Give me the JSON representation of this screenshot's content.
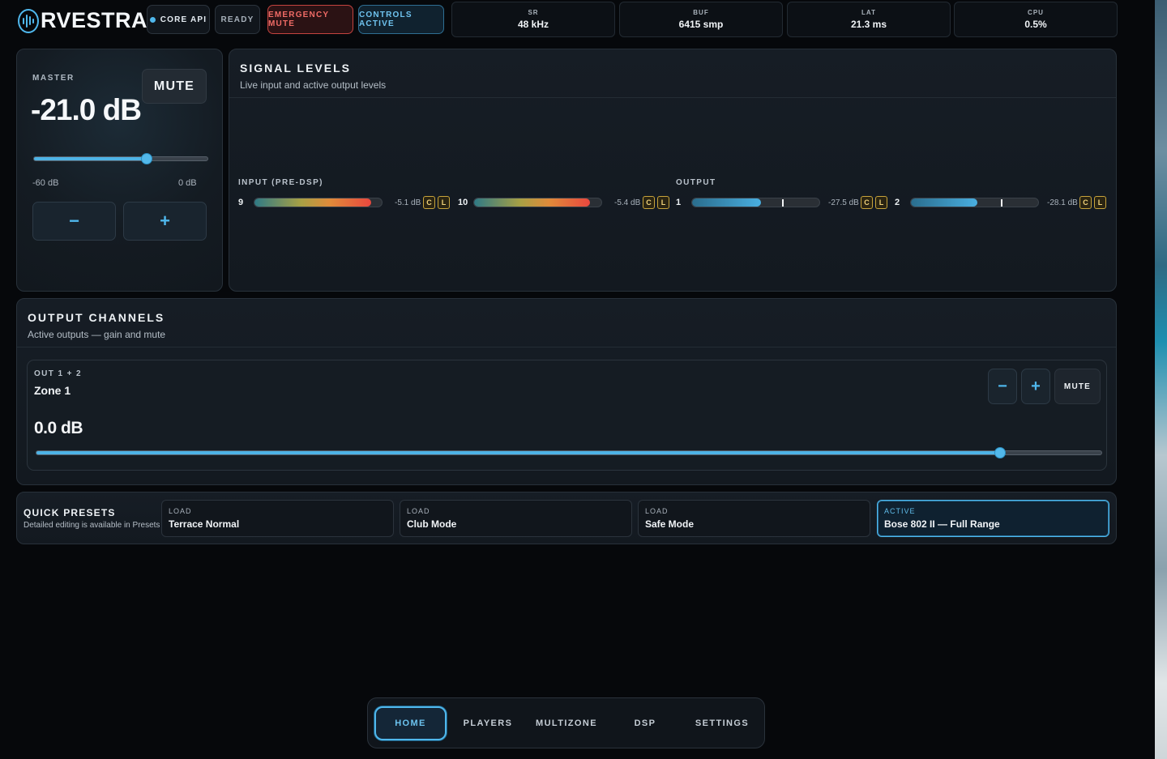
{
  "header": {
    "logo_text": "RVESTRA",
    "status": {
      "core_api": "CORE API",
      "ready": "READY",
      "emergency_mute": "EMERGENCY MUTE",
      "controls_active": "CONTROLS ACTIVE"
    },
    "stats": [
      {
        "label": "SR",
        "value": "48 kHz"
      },
      {
        "label": "BUF",
        "value": "6415 smp"
      },
      {
        "label": "LAT",
        "value": "21.3 ms"
      },
      {
        "label": "CPU",
        "value": "0.5%"
      }
    ]
  },
  "master": {
    "label": "MASTER",
    "value": "-21.0 dB",
    "mute_label": "MUTE",
    "range_min": "-60 dB",
    "range_max": "0 dB",
    "level_fraction": 0.65,
    "minus": "−",
    "plus": "+"
  },
  "signal_levels": {
    "title": "SIGNAL LEVELS",
    "subtitle": "Live input and active output levels",
    "input_label": "INPUT (PRE-DSP)",
    "output_label": "OUTPUT",
    "inputs": [
      {
        "ch": "9",
        "db": "-5.1 dB",
        "level": 0.92,
        "badges": [
          "C",
          "L"
        ]
      },
      {
        "ch": "10",
        "db": "-5.4 dB",
        "level": 0.91,
        "badges": [
          "C",
          "L"
        ]
      }
    ],
    "outputs": [
      {
        "ch": "1",
        "db": "-27.5 dB",
        "level": 0.54,
        "peak": 0.71,
        "badges": [
          "C",
          "L"
        ]
      },
      {
        "ch": "2",
        "db": "-28.1 dB",
        "level": 0.52,
        "peak": 0.71,
        "badges": [
          "C",
          "L"
        ]
      }
    ]
  },
  "output_channels": {
    "title": "OUTPUT CHANNELS",
    "subtitle": "Active outputs — gain and mute",
    "zone": {
      "tag": "OUT 1 + 2",
      "name": "Zone 1",
      "value": "0.0 dB",
      "level_fraction": 0.905,
      "minus": "−",
      "plus": "+",
      "mute_label": "MUTE"
    }
  },
  "presets": {
    "title": "QUICK PRESETS",
    "subtitle": "Detailed editing is available in Presets",
    "items": [
      {
        "status": "LOAD",
        "name": "Terrace Normal"
      },
      {
        "status": "LOAD",
        "name": "Club Mode"
      },
      {
        "status": "LOAD",
        "name": "Safe Mode"
      },
      {
        "status": "ACTIVE",
        "name": "Bose 802 II — Full Range"
      }
    ]
  },
  "nav": {
    "items": [
      "HOME",
      "PLAYERS",
      "MULTIZONE",
      "DSP",
      "SETTINGS"
    ],
    "active": "HOME"
  },
  "colors": {
    "accent": "#4fb7ec",
    "emergency": "#f06b66",
    "badge": "#f0d27a"
  }
}
